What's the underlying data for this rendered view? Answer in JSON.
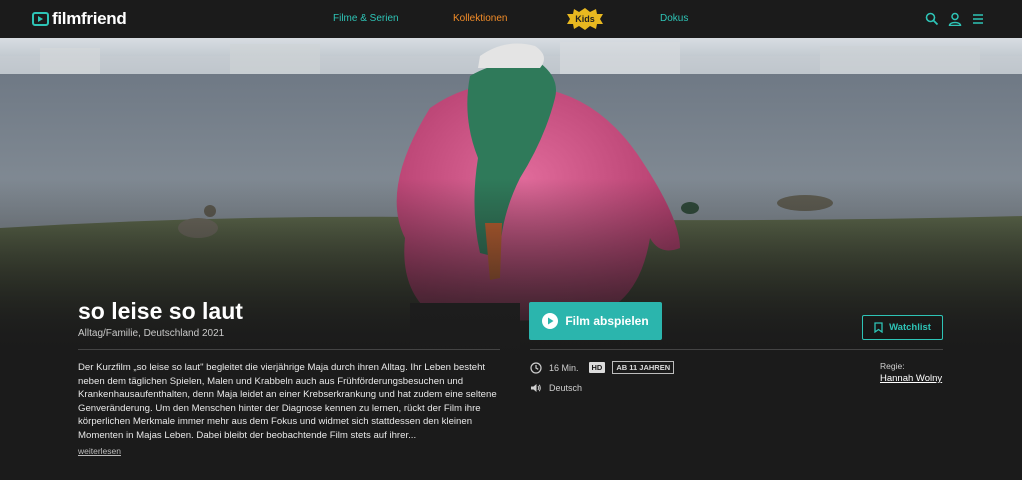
{
  "header": {
    "logo_text": "filmfriend",
    "nav": {
      "series": "Filme & Serien",
      "collections": "Kollektionen",
      "kids": "Kids",
      "docs": "Dokus"
    },
    "icons": [
      "search-icon",
      "user-icon",
      "menu-icon"
    ]
  },
  "film": {
    "title": "so leise so laut",
    "genre_line": "Alltag/Familie, Deutschland 2021",
    "description": "Der Kurzfilm „so leise so laut\" begleitet die vierjährige Maja durch ihren Alltag. Ihr Leben besteht neben dem täglichen Spielen, Malen und Krabbeln auch aus Frühförderungsbesuchen und Krankenhausaufenthalten, denn Maja leidet an einer Krebserkrankung und hat zudem eine seltene Genveränderung. Um den Menschen hinter der Diagnose kennen zu lernen, rückt der Film ihre körperlichen Merkmale immer mehr aus dem Fokus und widmet sich stattdessen den kleinen Momenten in Majas Leben. Dabei bleibt der beobachtende Film stets auf ihrer...",
    "read_more": "weiterlesen",
    "duration": "16 Min.",
    "quality_badge": "HD",
    "age_badge": "AB 11 JAHREN",
    "language": "Deutsch",
    "director_label": "Regie:",
    "director_name": "Hannah Wolny"
  },
  "actions": {
    "play_label": "Film abspielen",
    "watchlist_label": "Watchlist"
  },
  "colors": {
    "accent": "#2ec4b6",
    "play_button": "#2bb5ad",
    "collections": "#f28c28",
    "kids_badge": "#e8b820",
    "background": "#1b1b1b"
  }
}
